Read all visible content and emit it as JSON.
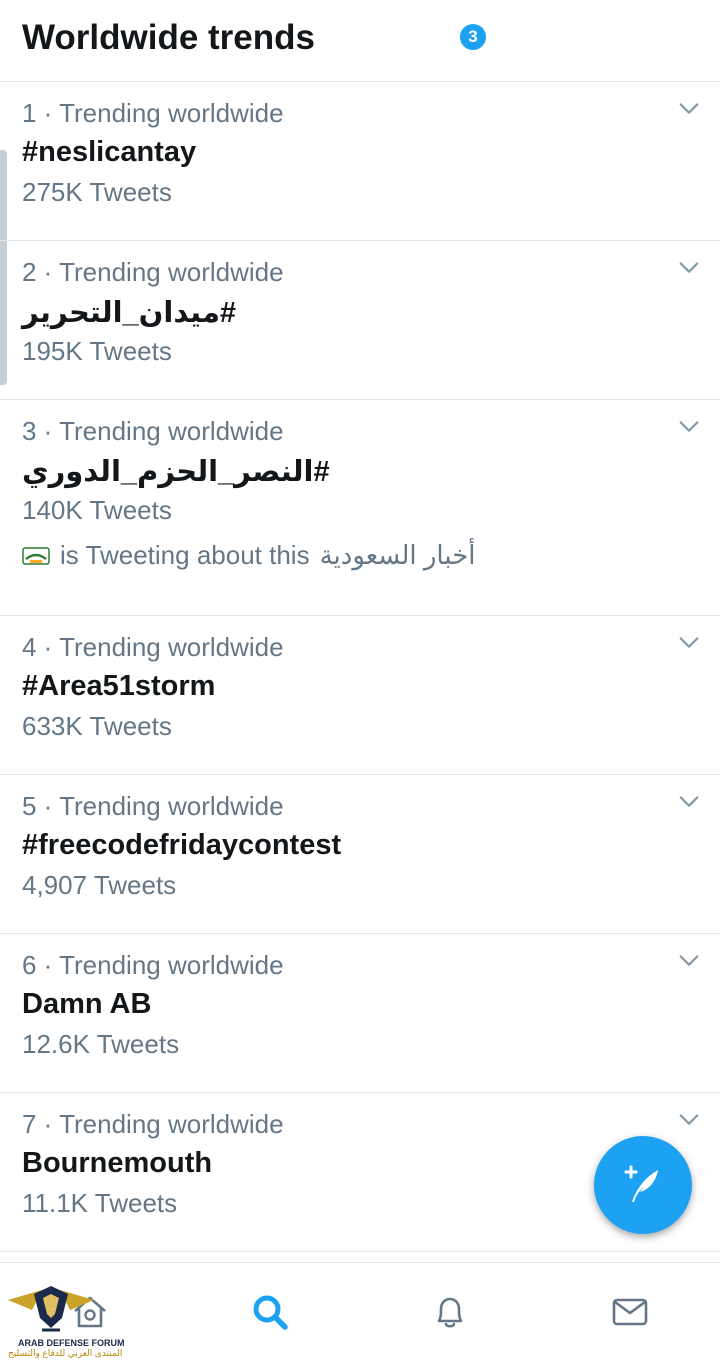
{
  "header": {
    "title": "Worldwide trends"
  },
  "trends": [
    {
      "meta": "1 · Trending worldwide",
      "name": "#neslicantay",
      "count": "275K Tweets"
    },
    {
      "meta": "2 · Trending worldwide",
      "name": "#ميدان_التحرير",
      "count": "195K Tweets"
    },
    {
      "meta": "3 · Trending worldwide",
      "name": "#النصر_الحزم_الدوري",
      "count": "140K Tweets",
      "context": {
        "account": "أخبار السعودية",
        "text": "is Tweeting about this"
      }
    },
    {
      "meta": "4 · Trending worldwide",
      "name": "#Area51storm",
      "count": "633K Tweets"
    },
    {
      "meta": "5 · Trending worldwide",
      "name": "#freecodefridaycontest",
      "count": "4,907 Tweets"
    },
    {
      "meta": "6 · Trending worldwide",
      "name": "Damn AB",
      "count": "12.6K Tweets"
    },
    {
      "meta": "7 · Trending worldwide",
      "name": "Bournemouth",
      "count": "11.1K Tweets"
    }
  ],
  "fab": {
    "icon": "compose-tweet-icon"
  },
  "tabs": [
    {
      "name": "home",
      "icon": "home-icon"
    },
    {
      "name": "search",
      "icon": "search-icon",
      "active": true
    },
    {
      "name": "notifications",
      "icon": "bell-icon",
      "badge": "3"
    },
    {
      "name": "messages",
      "icon": "mail-icon"
    }
  ],
  "watermark": {
    "line1": "ARAB DEFENSE FORUM",
    "line2": "المنتدى العربي للدفاع والتسليح"
  },
  "colors": {
    "accent": "#1da1f2",
    "secondary_text": "#657786",
    "divider": "#e1e8ed"
  }
}
